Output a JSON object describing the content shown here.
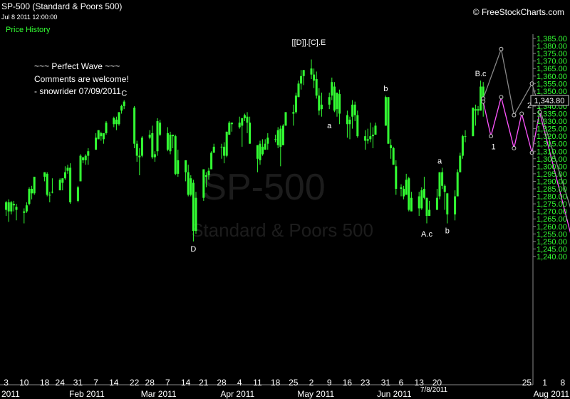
{
  "header": {
    "title": "SP-500 (Standard & Poors 500)",
    "datetime": "Jul 8 2011 12:00:00",
    "tab": "Price History",
    "brand": "© FreeStockCharts.com"
  },
  "watermark": {
    "symbol": "SP-500",
    "name": "Standard & Poors 500"
  },
  "annotations": [
    "~~~ Perfect Wave ~~~",
    "Comments are welcome!",
    "- snowrider  07/09/2011"
  ],
  "colors": {
    "background": "#000000",
    "candle": "#33ff33",
    "projection_gray": "#888888",
    "projection_pink": "#ff55ff",
    "text": "#ffffff"
  },
  "chart_data": {
    "type": "candlestick",
    "ylim": [
      1240,
      1385
    ],
    "y_ticks": [
      "1,385.00",
      "1,380.00",
      "1,375.00",
      "1,370.00",
      "1,365.00",
      "1,360.00",
      "1,355.00",
      "1,350.00",
      "1,345.00",
      "1,340.00",
      "1,335.00",
      "1,330.00",
      "1,325.00",
      "1,320.00",
      "1,315.00",
      "1,310.00",
      "1,305.00",
      "1,300.00",
      "1,295.00",
      "1,290.00",
      "1,285.00",
      "1,280.00",
      "1,275.00",
      "1,270.00",
      "1,265.00",
      "1,260.00",
      "1,255.00",
      "1,250.00",
      "1,245.00",
      "1,240.00"
    ],
    "last_price": "1,343.80",
    "cursor_date": "7/8/2011",
    "x_labels": [
      {
        "label": "3",
        "day": 3
      },
      {
        "label": "10",
        "day": 10
      },
      {
        "label": "18",
        "day": 18
      },
      {
        "label": "24",
        "day": 24
      },
      {
        "label": "31",
        "day": 31
      },
      {
        "label": "7",
        "day": 38
      },
      {
        "label": "14",
        "day": 45
      },
      {
        "label": "22",
        "day": 53
      },
      {
        "label": "28",
        "day": 59
      },
      {
        "label": "7",
        "day": 66
      },
      {
        "label": "14",
        "day": 73
      },
      {
        "label": "21",
        "day": 80
      },
      {
        "label": "28",
        "day": 87
      },
      {
        "label": "4",
        "day": 94
      },
      {
        "label": "11",
        "day": 101
      },
      {
        "label": "18",
        "day": 108
      },
      {
        "label": "25",
        "day": 115
      },
      {
        "label": "2",
        "day": 122
      },
      {
        "label": "9",
        "day": 129
      },
      {
        "label": "16",
        "day": 136
      },
      {
        "label": "23",
        "day": 143
      },
      {
        "label": "31",
        "day": 151
      },
      {
        "label": "6",
        "day": 157
      },
      {
        "label": "13",
        "day": 164
      },
      {
        "label": "20",
        "day": 171
      },
      {
        "label": "25",
        "day": 206
      },
      {
        "label": "1",
        "day": 213
      },
      {
        "label": "8",
        "day": 220
      }
    ],
    "month_labels": [
      {
        "label": "Feb 2011",
        "day": 32
      },
      {
        "label": "Mar 2011",
        "day": 60
      },
      {
        "label": "Apr 2011",
        "day": 91
      },
      {
        "label": "May 2011",
        "day": 121
      },
      {
        "label": "Jun 2011",
        "day": 152
      },
      {
        "label": "Aug 2011",
        "day": 213
      }
    ],
    "year_label": "2011",
    "candles": [
      [
        3,
        1271,
        1277,
        1267,
        1276
      ],
      [
        4,
        1276,
        1278,
        1263,
        1270
      ],
      [
        5,
        1270,
        1277,
        1268,
        1276
      ],
      [
        6,
        1275,
        1277,
        1270,
        1274
      ],
      [
        7,
        1273,
        1275,
        1264,
        1271
      ],
      [
        10,
        1270,
        1272,
        1262,
        1269
      ],
      [
        11,
        1270,
        1276,
        1269,
        1274
      ],
      [
        12,
        1275,
        1286,
        1274,
        1285
      ],
      [
        13,
        1285,
        1287,
        1278,
        1282
      ],
      [
        14,
        1282,
        1293,
        1281,
        1293
      ],
      [
        18,
        1293,
        1296,
        1290,
        1296
      ],
      [
        19,
        1295,
        1296,
        1280,
        1281
      ],
      [
        20,
        1281,
        1283,
        1276,
        1281
      ],
      [
        21,
        1283,
        1292,
        1282,
        1283
      ],
      [
        24,
        1284,
        1292,
        1284,
        1291
      ],
      [
        25,
        1289,
        1292,
        1284,
        1292
      ],
      [
        26,
        1292,
        1300,
        1291,
        1296
      ],
      [
        27,
        1297,
        1301,
        1295,
        1299
      ],
      [
        28,
        1299,
        1302,
        1275,
        1276
      ],
      [
        31,
        1277,
        1287,
        1276,
        1286
      ],
      [
        32,
        1290,
        1308,
        1290,
        1307
      ],
      [
        33,
        1306,
        1306,
        1302,
        1304
      ],
      [
        34,
        1304,
        1308,
        1301,
        1307
      ],
      [
        35,
        1307,
        1312,
        1301,
        1310
      ],
      [
        38,
        1311,
        1322,
        1311,
        1319
      ],
      [
        39,
        1318,
        1324,
        1318,
        1324
      ],
      [
        40,
        1322,
        1323,
        1317,
        1320
      ],
      [
        41,
        1318,
        1322,
        1315,
        1322
      ],
      [
        42,
        1322,
        1330,
        1321,
        1329
      ],
      [
        45,
        1328,
        1333,
        1326,
        1332
      ],
      [
        46,
        1331,
        1333,
        1324,
        1328
      ],
      [
        47,
        1328,
        1336,
        1327,
        1336
      ],
      [
        48,
        1337,
        1341,
        1335,
        1340
      ],
      [
        49,
        1340,
        1344,
        1338,
        1343
      ],
      [
        53,
        1339,
        1340,
        1312,
        1315
      ],
      [
        54,
        1315,
        1317,
        1303,
        1307
      ],
      [
        55,
        1306,
        1312,
        1294,
        1307
      ],
      [
        56,
        1307,
        1320,
        1306,
        1319
      ],
      [
        59,
        1319,
        1324,
        1318,
        1321
      ],
      [
        60,
        1322,
        1327,
        1305,
        1306
      ],
      [
        61,
        1306,
        1310,
        1303,
        1308
      ],
      [
        62,
        1310,
        1332,
        1307,
        1330
      ],
      [
        63,
        1329,
        1331,
        1320,
        1321
      ],
      [
        66,
        1322,
        1326,
        1310,
        1311
      ],
      [
        67,
        1310,
        1323,
        1308,
        1321
      ],
      [
        68,
        1321,
        1321,
        1312,
        1320
      ],
      [
        69,
        1320,
        1321,
        1294,
        1295
      ],
      [
        70,
        1295,
        1311,
        1293,
        1304
      ],
      [
        73,
        1304,
        1304,
        1290,
        1296
      ],
      [
        74,
        1296,
        1301,
        1280,
        1281
      ],
      [
        75,
        1281,
        1294,
        1280,
        1292
      ],
      [
        76,
        1289,
        1291,
        1250,
        1257
      ],
      [
        77,
        1257,
        1283,
        1255,
        1279
      ],
      [
        80,
        1279,
        1289,
        1277,
        1298
      ],
      [
        81,
        1294,
        1296,
        1286,
        1293
      ],
      [
        82,
        1294,
        1299,
        1291,
        1297
      ],
      [
        83,
        1298,
        1310,
        1298,
        1309
      ],
      [
        84,
        1309,
        1315,
        1310,
        1313
      ],
      [
        87,
        1313,
        1315,
        1305,
        1313
      ],
      [
        88,
        1313,
        1316,
        1302,
        1307
      ],
      [
        89,
        1307,
        1323,
        1306,
        1323
      ],
      [
        90,
        1321,
        1330,
        1321,
        1329
      ],
      [
        91,
        1329,
        1329,
        1323,
        1328
      ],
      [
        94,
        1329,
        1333,
        1325,
        1326
      ],
      [
        95,
        1327,
        1332,
        1313,
        1332
      ],
      [
        96,
        1332,
        1335,
        1330,
        1334
      ],
      [
        97,
        1333,
        1336,
        1322,
        1329
      ],
      [
        98,
        1329,
        1333,
        1315,
        1315
      ],
      [
        101,
        1314,
        1314,
        1296,
        1305
      ],
      [
        102,
        1304,
        1317,
        1301,
        1315
      ],
      [
        103,
        1313,
        1318,
        1307,
        1308
      ],
      [
        104,
        1311,
        1318,
        1311,
        1315
      ],
      [
        105,
        1315,
        1322,
        1311,
        1319
      ],
      [
        108,
        1318,
        1321,
        1316,
        1318
      ],
      [
        109,
        1314,
        1326,
        1312,
        1324
      ],
      [
        110,
        1325,
        1327,
        1300,
        1313
      ],
      [
        111,
        1314,
        1328,
        1314,
        1327
      ],
      [
        112,
        1327,
        1336,
        1332,
        1336
      ],
      [
        115,
        1336,
        1341,
        1327,
        1335
      ],
      [
        116,
        1336,
        1349,
        1335,
        1347
      ],
      [
        117,
        1346,
        1357,
        1346,
        1355
      ],
      [
        118,
        1355,
        1364,
        1351,
        1360
      ],
      [
        119,
        1360,
        1364,
        1354,
        1364
      ],
      [
        122,
        1365,
        1371,
        1358,
        1361
      ],
      [
        123,
        1361,
        1365,
        1352,
        1357
      ],
      [
        124,
        1358,
        1363,
        1345,
        1347
      ],
      [
        125,
        1347,
        1352,
        1334,
        1337
      ],
      [
        126,
        1338,
        1349,
        1333,
        1341
      ],
      [
        129,
        1341,
        1349,
        1338,
        1346
      ],
      [
        130,
        1347,
        1359,
        1344,
        1356
      ],
      [
        131,
        1353,
        1356,
        1336,
        1337
      ],
      [
        132,
        1338,
        1349,
        1333,
        1349
      ],
      [
        133,
        1348,
        1351,
        1328,
        1335
      ],
      [
        136,
        1334,
        1337,
        1319,
        1328
      ],
      [
        137,
        1328,
        1333,
        1318,
        1331
      ],
      [
        138,
        1333,
        1344,
        1325,
        1341
      ],
      [
        139,
        1341,
        1343,
        1330,
        1334
      ],
      [
        140,
        1334,
        1337,
        1319,
        1320
      ],
      [
        143,
        1320,
        1324,
        1311,
        1317
      ],
      [
        144,
        1317,
        1325,
        1315,
        1318
      ],
      [
        145,
        1318,
        1329,
        1316,
        1320
      ],
      [
        146,
        1320,
        1326,
        1312,
        1321
      ],
      [
        147,
        1321,
        1329,
        1322,
        1327
      ],
      [
        151,
        1327,
        1347,
        1330,
        1346
      ],
      [
        152,
        1346,
        1346,
        1315,
        1315
      ],
      [
        153,
        1314,
        1318,
        1305,
        1312
      ],
      [
        154,
        1312,
        1313,
        1301,
        1301
      ],
      [
        155,
        1300,
        1304,
        1281,
        1285
      ],
      [
        157,
        1286,
        1288,
        1280,
        1285
      ],
      [
        158,
        1285,
        1287,
        1278,
        1280
      ],
      [
        159,
        1281,
        1295,
        1283,
        1291
      ],
      [
        160,
        1292,
        1293,
        1270,
        1271
      ],
      [
        161,
        1270,
        1283,
        1270,
        1279
      ],
      [
        164,
        1280,
        1283,
        1267,
        1272
      ],
      [
        165,
        1272,
        1286,
        1271,
        1284
      ],
      [
        166,
        1285,
        1293,
        1278,
        1279
      ],
      [
        167,
        1279,
        1274,
        1262,
        1267
      ],
      [
        168,
        1267,
        1277,
        1268,
        1271
      ],
      [
        171,
        1271,
        1285,
        1274,
        1279
      ],
      [
        172,
        1280,
        1296,
        1278,
        1296
      ],
      [
        173,
        1296,
        1299,
        1285,
        1287
      ],
      [
        174,
        1287,
        1288,
        1271,
        1283
      ],
      [
        175,
        1282,
        1270,
        1262,
        1268
      ],
      [
        178,
        1268,
        1284,
        1264,
        1280
      ],
      [
        179,
        1280,
        1298,
        1280,
        1296
      ],
      [
        180,
        1296,
        1309,
        1296,
        1307
      ],
      [
        181,
        1307,
        1321,
        1305,
        1320
      ],
      [
        182,
        1320,
        1324,
        1316,
        1320
      ],
      [
        185,
        1320,
        1338,
        1320,
        1339
      ],
      [
        186,
        1338,
        1341,
        1327,
        1337
      ],
      [
        187,
        1338,
        1340,
        1334,
        1337
      ],
      [
        188,
        1337,
        1357,
        1338,
        1353
      ],
      [
        189,
        1353,
        1356,
        1333,
        1343.8
      ]
    ],
    "wave_labels": [
      {
        "text": "C",
        "day": 49,
        "price": 1344,
        "pos": "above"
      },
      {
        "text": "D",
        "day": 76,
        "price": 1250,
        "pos": "below"
      },
      {
        "text": "[[D]].[C].E",
        "day": 121,
        "price": 1378,
        "pos": "above"
      },
      {
        "text": "a",
        "day": 129,
        "price": 1332,
        "pos": "below"
      },
      {
        "text": "b",
        "day": 151,
        "price": 1347,
        "pos": "above"
      },
      {
        "text": "A.c",
        "day": 167,
        "price": 1260,
        "pos": "below"
      },
      {
        "text": "a",
        "day": 172,
        "price": 1299,
        "pos": "above"
      },
      {
        "text": "b",
        "day": 175,
        "price": 1262,
        "pos": "below"
      },
      {
        "text": "B.c",
        "day": 188,
        "price": 1357,
        "pos": "above"
      },
      {
        "text": "1",
        "day": 193,
        "price": 1318,
        "pos": "below"
      },
      {
        "text": "2",
        "day": 207,
        "price": 1336,
        "pos": "above"
      }
    ],
    "series": [
      {
        "color": "#888888",
        "points": [
          [
            189,
            1345
          ],
          [
            196,
            1378
          ],
          [
            201,
            1334
          ],
          [
            208,
            1355
          ],
          [
            224,
            1267
          ],
          [
            230,
            1291
          ]
        ]
      },
      {
        "color": "#ff55ff",
        "points": [
          [
            189,
            1343
          ],
          [
            192,
            1320
          ],
          [
            196,
            1346
          ],
          [
            201,
            1312
          ],
          [
            204,
            1335
          ],
          [
            208,
            1309
          ],
          [
            211,
            1336
          ],
          [
            224,
            1249
          ]
        ]
      }
    ]
  }
}
